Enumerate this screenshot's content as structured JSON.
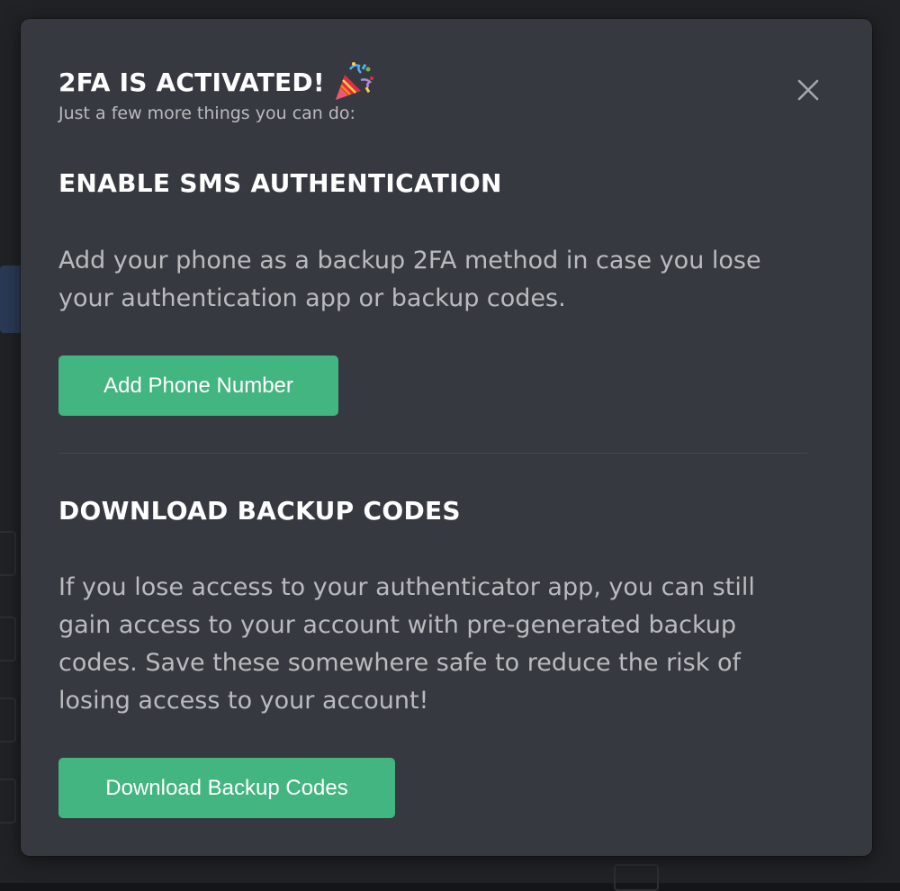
{
  "modal": {
    "title": "2FA IS ACTIVATED!",
    "subtitle": "Just a few more things you can do:"
  },
  "sms": {
    "heading": "ENABLE SMS AUTHENTICATION",
    "description": "Add your phone as a backup 2FA method in case you lose your authentication app or backup codes.",
    "button_label": "Add Phone Number"
  },
  "backup": {
    "heading": "DOWNLOAD BACKUP CODES",
    "description": "If you lose access to your authenticator app, you can still gain access to your account with pre-generated backup codes. Save these somewhere safe to reduce the risk of losing access to your account!",
    "button_label": "Download Backup Codes"
  },
  "colors": {
    "modal_bg": "#36393f",
    "button_green": "#43b581",
    "heading_text": "#ffffff",
    "body_text": "#b9bbbe"
  },
  "icons": {
    "celebration": "party-popper-icon",
    "close": "close-icon"
  }
}
